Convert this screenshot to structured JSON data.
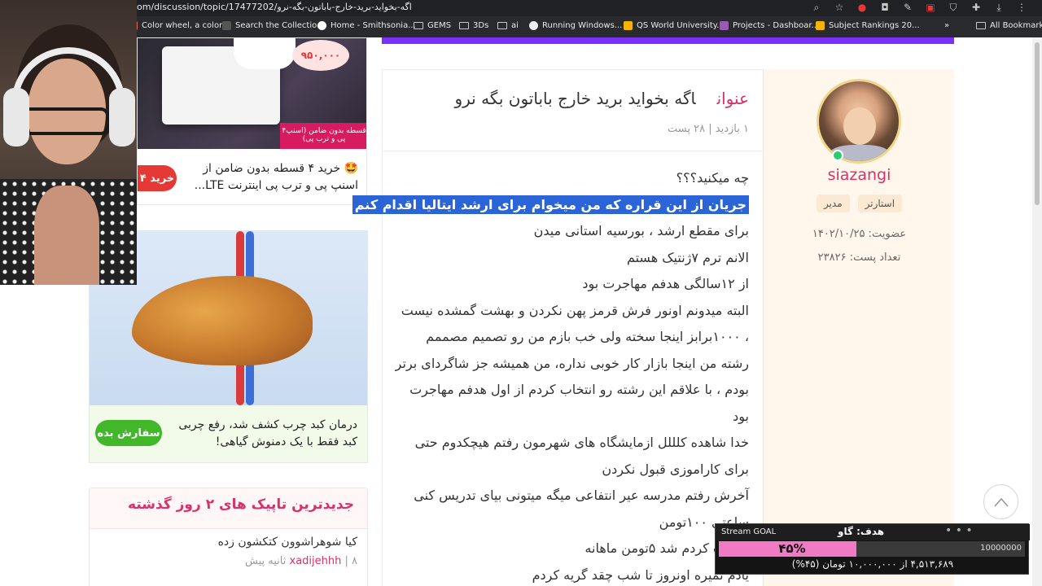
{
  "browser": {
    "url": "om/discussion/topic/17477202/اگه-بخواید-برید-خارج-باباتون-بگه-نرو",
    "bookmarks": [
      {
        "label": "Color wheel, a color...",
        "color": "#e66"
      },
      {
        "label": "Search the Collectio...",
        "color": "#333"
      },
      {
        "label": "Home - Smithsonia...",
        "color": "#fff"
      },
      {
        "label": "GEMS",
        "color": "folder"
      },
      {
        "label": "3Ds",
        "color": "folder"
      },
      {
        "label": "ai",
        "color": "folder"
      },
      {
        "label": "Running Windows...",
        "color": "#eee"
      },
      {
        "label": "QS World University...",
        "color": "#f5b400"
      },
      {
        "label": "Projects - Dashboar...",
        "color": "#9b59b6"
      },
      {
        "label": "Subject Rankings 20...",
        "color": "#f5b400"
      }
    ],
    "all_bookmarks": "All Bookmarks",
    "more": "»"
  },
  "ads": {
    "ad1": {
      "price": "۹۵۰,۰۰۰",
      "banner": "۴قسطه بدون ضامن (اسنپ پی و ترب پی)",
      "text": "🤩 خرید ۴ قسطه بدون ضامن از اسنپ پی و ترب پی اینترنت LTE...",
      "button": "خرید ۴"
    },
    "ad2": {
      "text": "درمان کبد چرب کشف شد، رفع چربی کبد فقط با یک دمنوش گیاهی!",
      "button": "سفارش بده"
    }
  },
  "latest": {
    "heading": "جدیدترین تاپیک های ۲ روز گذشته",
    "items": [
      {
        "title": "کیا شوهراشوون کتکشون زده",
        "user": "xadijehhh",
        "time": "۸ ثانیه پیش"
      }
    ]
  },
  "topic": {
    "label": "عنوان",
    "title": "اگه بخواید برید خارج باباتون بگه نرو",
    "meta": "۱ بازدید | ۲۸ پست"
  },
  "author": {
    "username": "siazangi",
    "badges": [
      "استارتر",
      "مدیر"
    ],
    "joined": "عضویت: ۱۴۰۲/۱۰/۲۵",
    "posts": "تعداد پست: ۲۳۸۲۶"
  },
  "post": {
    "lines": [
      "چه میکنید؟؟؟",
      "جریان از این قراره که من میخوام برای ارشد ایتالیا اقدام کنم",
      "برای مقطع ارشد ، بورسیه استانی میدن",
      "الانم ترم ۷ژنتیک هستم",
      "از ۱۲سالگی هدفم مهاجرت بود",
      "البته میدونم اونور فرش قرمز پهن نکردن و بهشت گمشده نیست",
      "، ۱۰۰۰برابز اینجا سخته ولی خب بازم من  رو تصمیم مصممم",
      "رشته من اینجا بازار کار خوبی نداره،  من همیشه جز شاگردای برتر",
      "بودم ، با علاقم این رشته رو انتخاب کردم از اول هدفم مهاجرت",
      "بود",
      "خدا شاهده کلللل ازمایشگاه های شهرمون رفتم هیچکدوم حتی",
      "برای کاراموزی قبول نکردن",
      "آخرش رفتم مدرسه عیر انتفاعی میگه میتونی بیای تدریس کنی",
      "ساعتی ۱۰۰تومن",
      "حساب کردم شد ۵تومن ماهانه",
      "یادم نمیره اونروز تا شب چقد گریه کردم"
    ],
    "highlight_index": 1
  },
  "stream_goal": {
    "label": "Stream GOAL",
    "title": "هدف: گاو",
    "dots": "• • •",
    "percent_text": "۴۵%",
    "progress": 0.45,
    "target": "10000000",
    "summary": "۴,۵۱۳,۶۸۹ از ۱۰,۰۰۰,۰۰۰ تومان (۴۵%)"
  }
}
